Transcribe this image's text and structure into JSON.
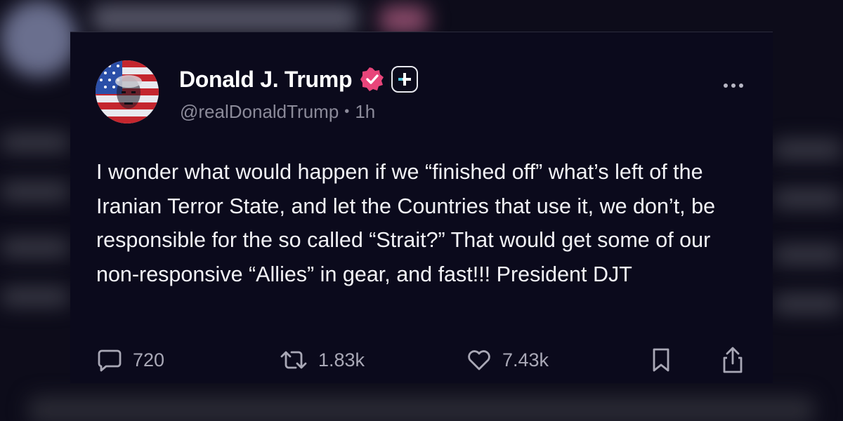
{
  "post": {
    "author": {
      "display_name": "Donald J. Trump",
      "handle": "@realDonaldTrump",
      "time": "1h",
      "avatar_icon": "avatar-image",
      "verified_color": "#e8457a"
    },
    "text": "I wonder what would happen if we “finished off” what’s left of the Iranian Terror State, and let the Countries that use it, we don’t, be responsible for the so called “Strait?” That would get some of our non-responsive “Allies” in gear, and fast!!! President DJT",
    "actions": {
      "replies": "720",
      "reposts": "1.83k",
      "likes": "7.43k"
    }
  },
  "colors": {
    "background": "#0b0a1c",
    "text": "#f2f2f6",
    "muted": "#8b8a99"
  }
}
